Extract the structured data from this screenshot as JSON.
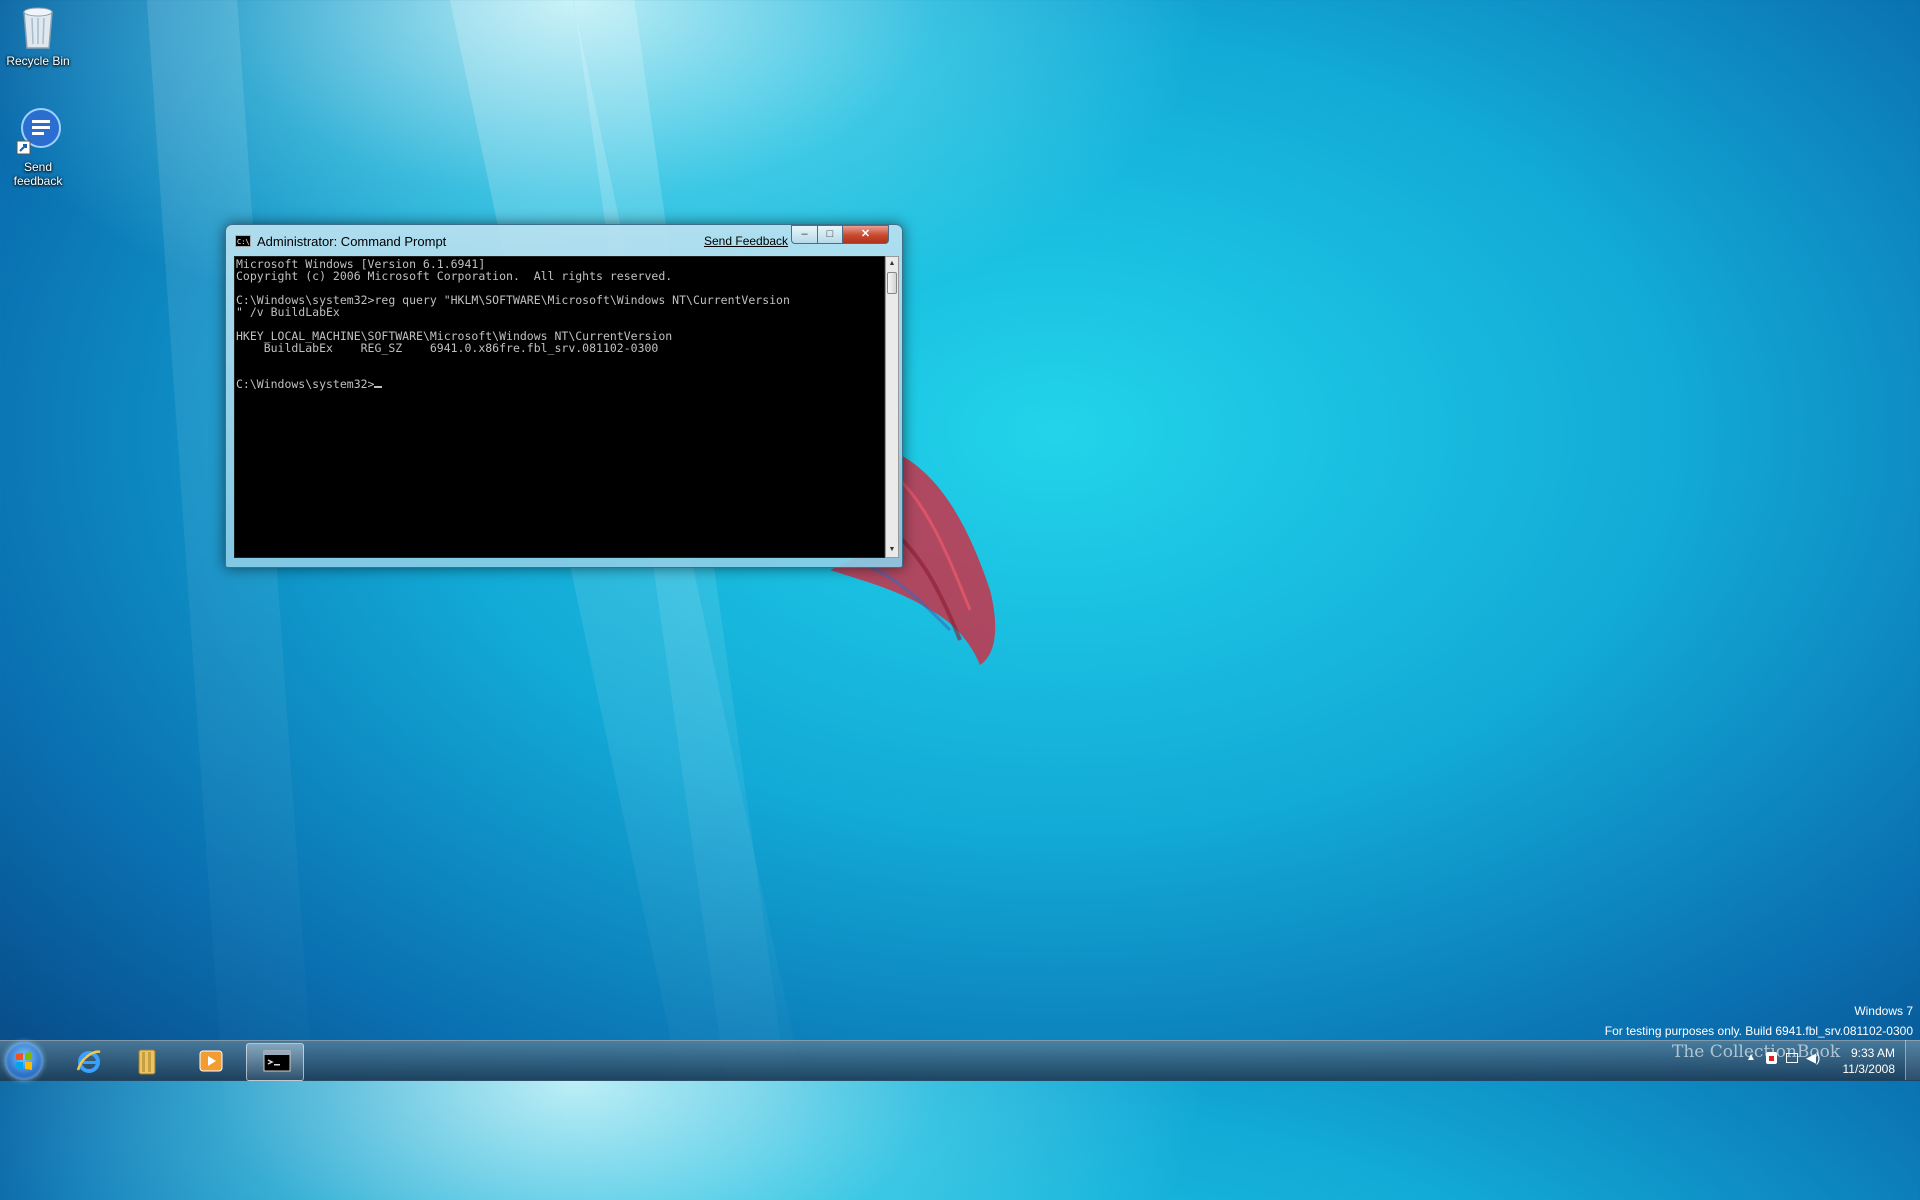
{
  "desktop": {
    "icons": [
      {
        "label": "Recycle Bin",
        "icon": "recycle-bin-icon"
      },
      {
        "label": "Send\nfeedback",
        "icon": "send-feedback-icon"
      }
    ]
  },
  "cmd_window": {
    "title": "Administrator: Command Prompt",
    "send_feedback": "Send Feedback",
    "controls": {
      "minimize": "‒",
      "maximize": "□",
      "close": "✕"
    },
    "console_lines": [
      "Microsoft Windows [Version 6.1.6941]",
      "Copyright (c) 2006 Microsoft Corporation.  All rights reserved.",
      "",
      "C:\\Windows\\system32>reg query \"HKLM\\SOFTWARE\\Microsoft\\Windows NT\\CurrentVersion",
      "\" /v BuildLabEx",
      "",
      "HKEY_LOCAL_MACHINE\\SOFTWARE\\Microsoft\\Windows NT\\CurrentVersion",
      "    BuildLabEx    REG_SZ    6941.0.x86fre.fbl_srv.081102-0300",
      "",
      "",
      "C:\\Windows\\system32>"
    ]
  },
  "watermark": {
    "line1": "Windows 7",
    "line2": "For testing purposes only. Build 6941.fbl_srv.081102-0300"
  },
  "taskbar": {
    "start": "start-orb-icon",
    "pinned": [
      {
        "name": "internet-explorer",
        "icon": "internet-explorer-icon"
      },
      {
        "name": "windows-explorer",
        "icon": "folder-library-icon"
      },
      {
        "name": "media-player",
        "icon": "media-player-icon"
      },
      {
        "name": "command-prompt",
        "icon": "command-prompt-icon",
        "active": true
      }
    ],
    "brand": "The CollectionBook",
    "clock": {
      "time": "9:33 AM",
      "date": "11/3/2008"
    }
  },
  "colors": {
    "desktop_accent": "#12a9d6",
    "console_bg": "#000000",
    "console_text": "#c0c0c0",
    "close_button": "#c8482e"
  }
}
